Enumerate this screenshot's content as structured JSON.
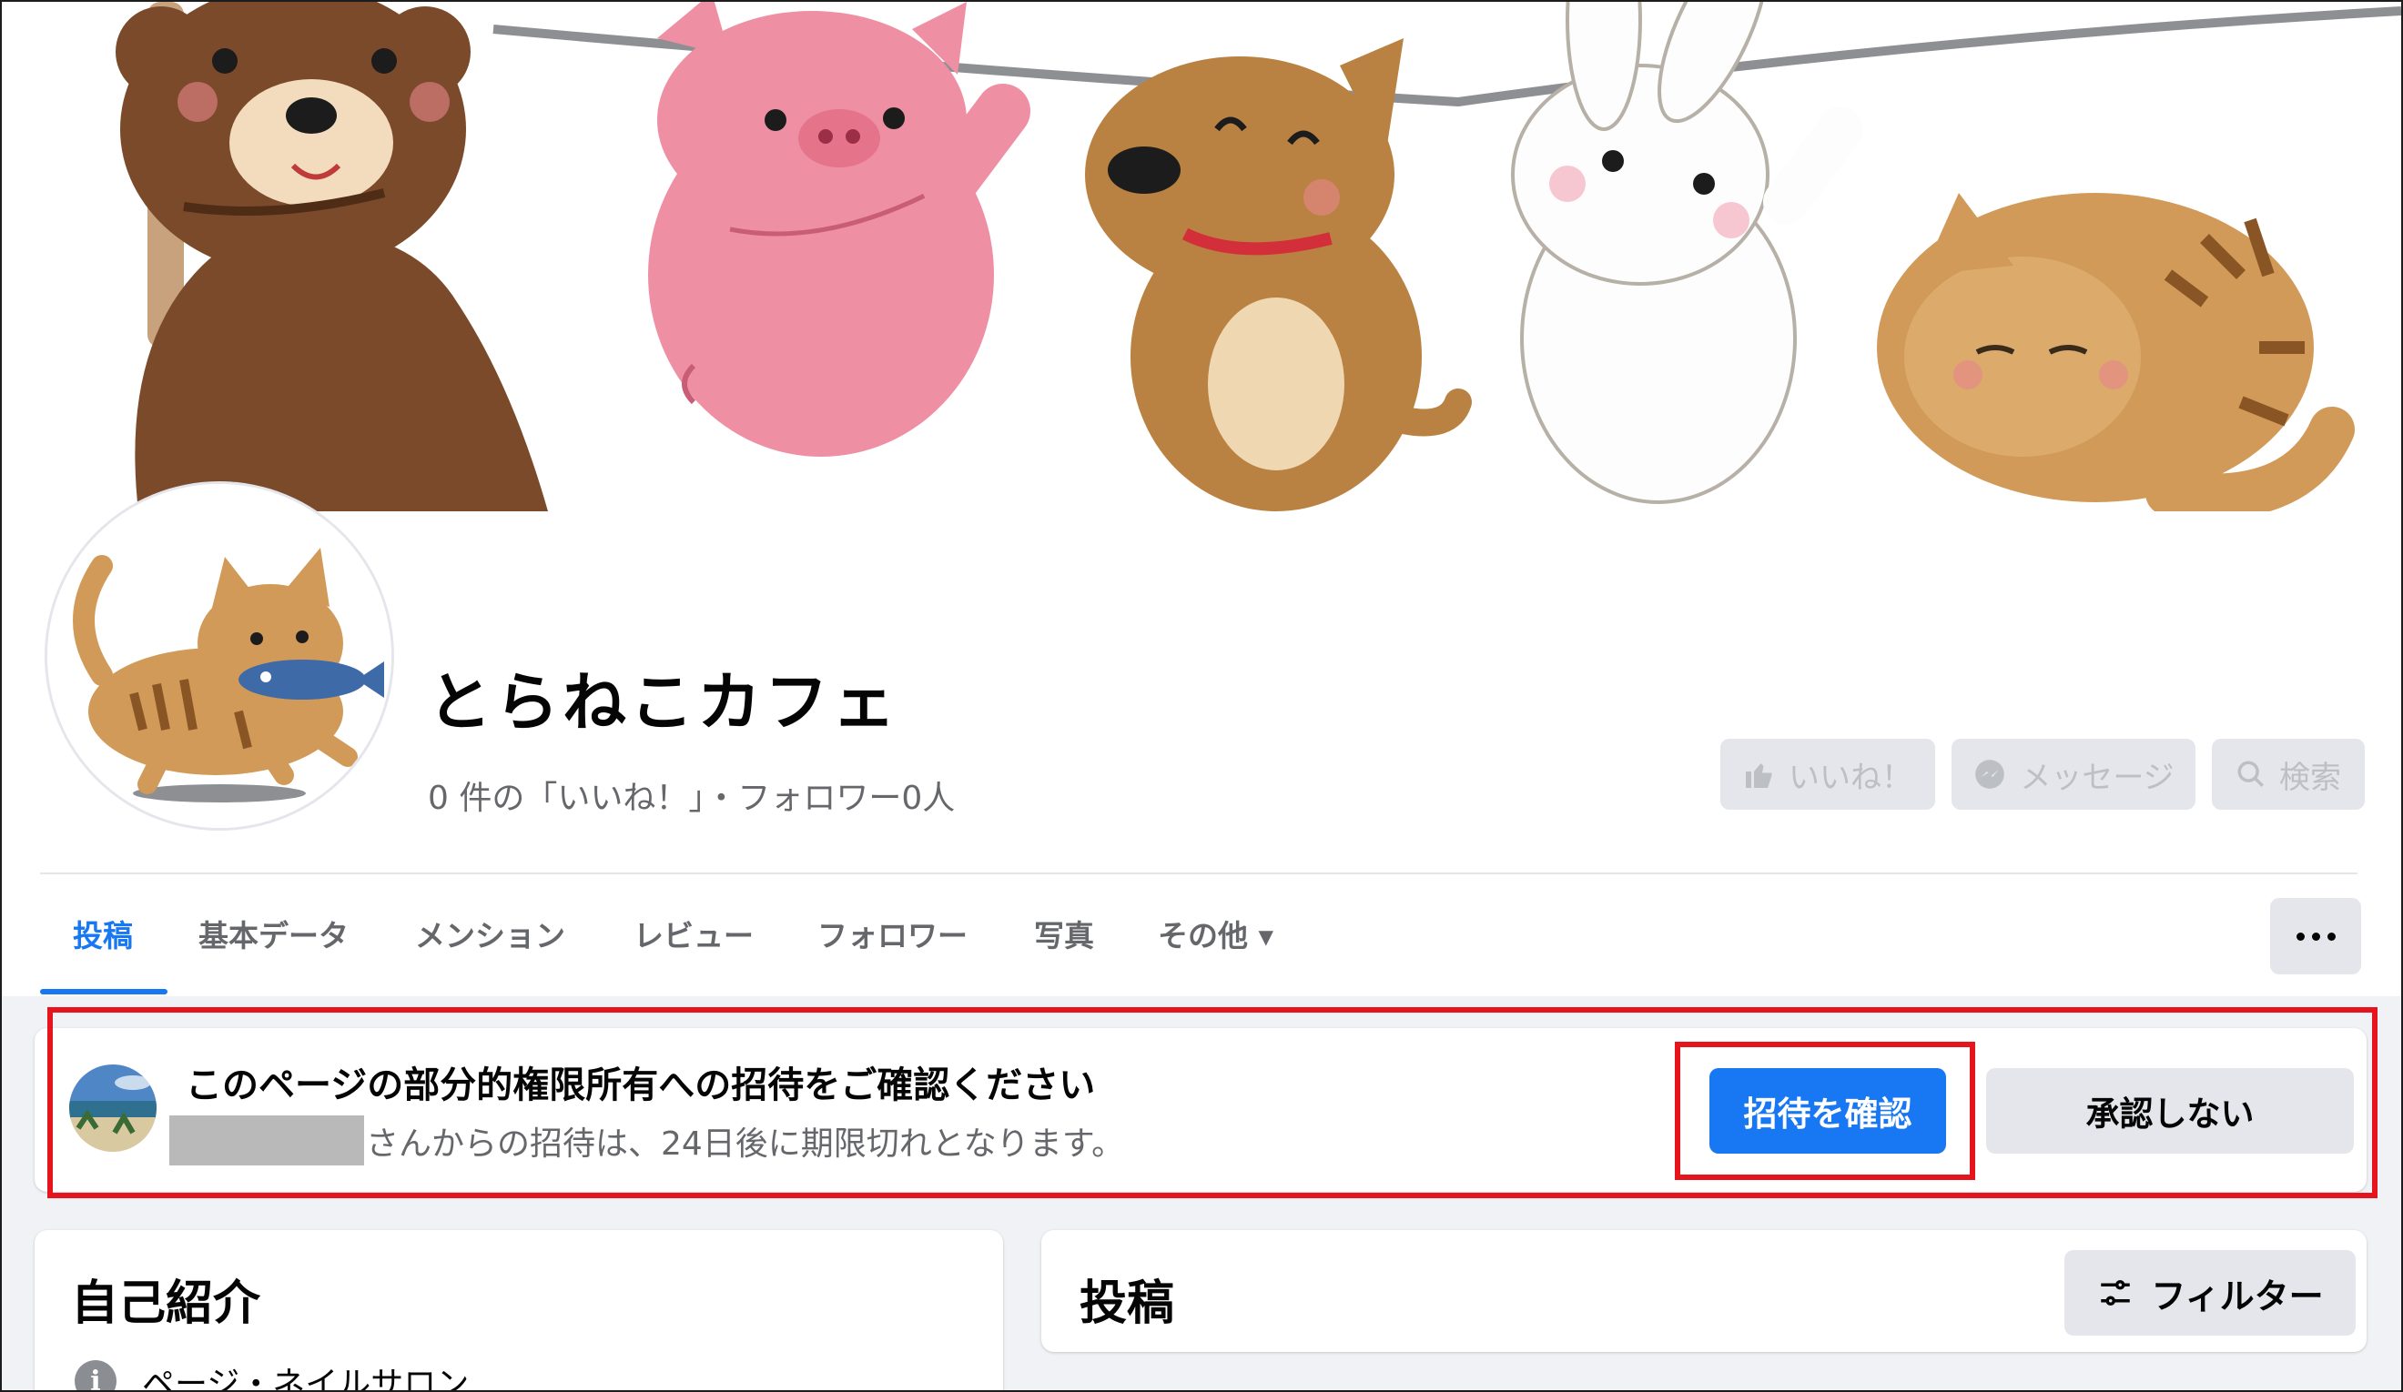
{
  "page": {
    "title": "とらねこカフェ",
    "stats": "0 件の「いいね！」・フォロワー0人"
  },
  "actions": {
    "like": "いいね！",
    "message": "メッセージ",
    "search": "検索"
  },
  "tabs": [
    {
      "label": "投稿",
      "active": true
    },
    {
      "label": "基本データ"
    },
    {
      "label": "メンション"
    },
    {
      "label": "レビュー"
    },
    {
      "label": "フォロワー"
    },
    {
      "label": "写真"
    },
    {
      "label": "その他 ▾"
    }
  ],
  "invite": {
    "title": "このページの部分的権限所有への招待をご確認ください",
    "subtitle": "さんからの招待は、24日後に期限切れとなります。",
    "confirm_label": "招待を確認",
    "decline_label": "承認しない"
  },
  "about": {
    "title": "自己紹介",
    "category": "ページ・ネイルサロン"
  },
  "posts": {
    "title": "投稿",
    "filter_label": "フィルター"
  },
  "colors": {
    "accent": "#1877f2",
    "highlight": "#e5141d",
    "background": "#f0f2f5"
  }
}
